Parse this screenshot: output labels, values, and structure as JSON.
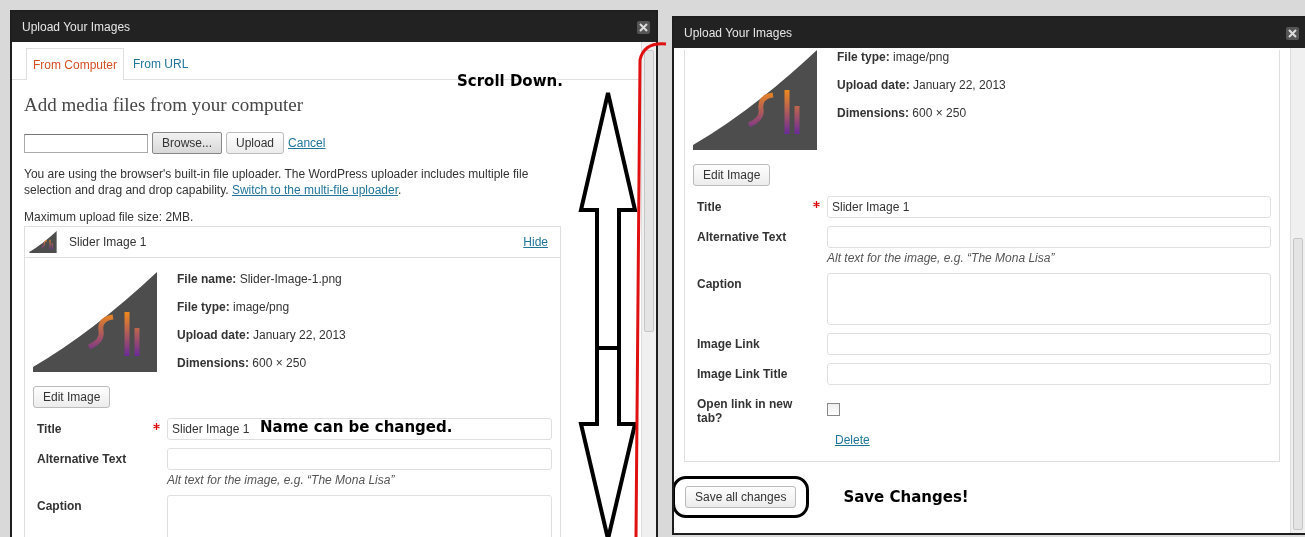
{
  "left_dialog": {
    "title": "Upload Your Images",
    "tabs": [
      {
        "label": "From Computer",
        "selected": true
      },
      {
        "label": "From URL",
        "selected": false
      }
    ],
    "heading": "Add media files from your computer",
    "browse_button": "Browse...",
    "upload_button": "Upload",
    "cancel_link": "Cancel",
    "notice": "You are using the browser's built-in file uploader. The WordPress uploader includes multiple file selection and drag and drop capability.",
    "switch_link": "Switch to the multi-file uploader",
    "notice_end": ".",
    "max_size": "Maximum upload file size: 2MB.",
    "item": {
      "name": "Slider Image 1",
      "toggle_link": "Hide",
      "details": [
        {
          "label": "File name:",
          "value": "Slider-Image-1.png"
        },
        {
          "label": "File type:",
          "value": "image/png"
        },
        {
          "label": "Upload date:",
          "value": "January 22, 2013"
        },
        {
          "label": "Dimensions:",
          "value": "600 × 250"
        }
      ],
      "edit_button": "Edit Image",
      "fields": [
        {
          "kind": "text",
          "label": "Title",
          "required": true,
          "value": "Slider Image 1",
          "note": "Name can be changed."
        },
        {
          "kind": "text",
          "label": "Alternative Text",
          "required": false,
          "help": "Alt text for the image, e.g. “The Mona Lisa”"
        },
        {
          "kind": "textarea",
          "label": "Caption",
          "required": false
        }
      ]
    },
    "annotation": "Scroll Down."
  },
  "right_dialog": {
    "title": "Upload Your Images",
    "details": [
      {
        "label": "File type:",
        "value": "image/png"
      },
      {
        "label": "Upload date:",
        "value": "January 22, 2013"
      },
      {
        "label": "Dimensions:",
        "value": "600 × 250"
      }
    ],
    "edit_button": "Edit Image",
    "fields": [
      {
        "kind": "text",
        "label": "Title",
        "required": true,
        "value": "Slider Image 1"
      },
      {
        "kind": "text",
        "label": "Alternative Text",
        "required": false,
        "help": "Alt text for the image, e.g. “The Mona Lisa”"
      },
      {
        "kind": "textarea",
        "label": "Caption",
        "required": false
      },
      {
        "kind": "text",
        "label": "Image Link",
        "required": false
      },
      {
        "kind": "text",
        "label": "Image Link Title",
        "required": false
      },
      {
        "kind": "checkbox",
        "label": "Open link in new tab?",
        "required": false,
        "checked": false
      }
    ],
    "delete_link": "Delete",
    "save_button": "Save all changes",
    "annotation": "Save Changes!"
  }
}
